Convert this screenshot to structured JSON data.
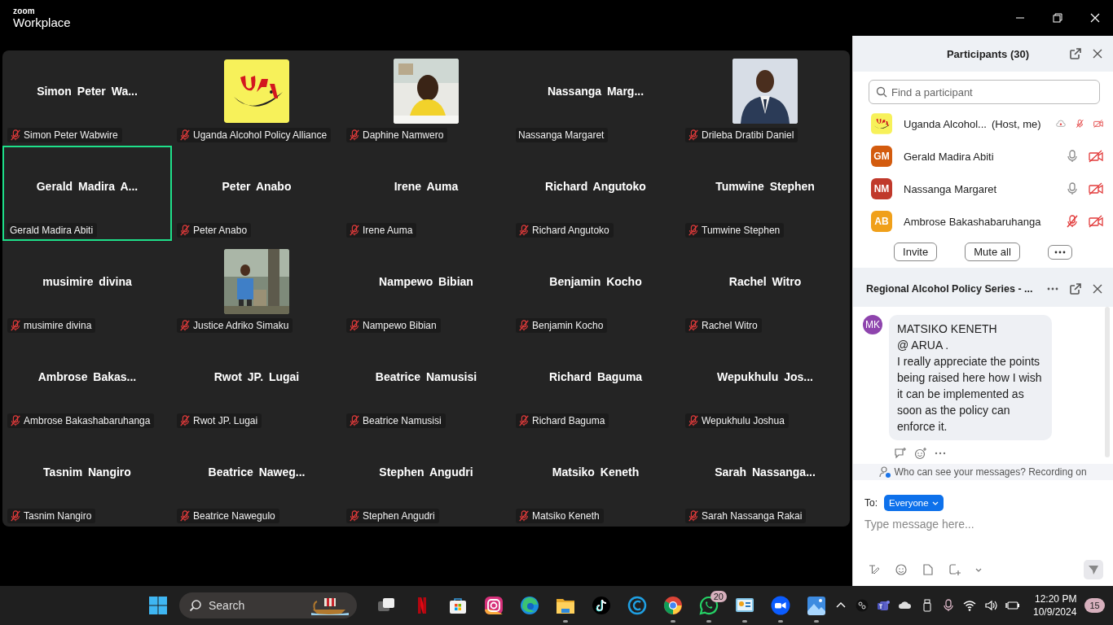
{
  "window": {
    "app_name": "zoom",
    "product": "Workplace"
  },
  "gallery": {
    "tiles": [
      {
        "kind": "name",
        "display_name": "Simon Peter Wa...",
        "label": "Simon Peter Wabwire",
        "muted": true,
        "speaking": false
      },
      {
        "kind": "logo",
        "label": "Uganda Alcohol Policy Alliance",
        "muted": true,
        "speaking": false
      },
      {
        "kind": "picture",
        "label": "Daphine Namwero",
        "muted": true,
        "speaking": false
      },
      {
        "kind": "name",
        "display_name": "Nassanga Marg...",
        "label": "Nassanga Margaret",
        "muted": false,
        "speaking": false
      },
      {
        "kind": "picture",
        "label": "Drileba Dratibi Daniel",
        "muted": true,
        "speaking": false
      },
      {
        "kind": "name",
        "display_name": "Gerald Madira A...",
        "label": "Gerald Madira Abiti",
        "muted": false,
        "speaking": true
      },
      {
        "kind": "name",
        "display_name": "Peter Anabo",
        "label": "Peter Anabo",
        "muted": true,
        "speaking": false
      },
      {
        "kind": "name",
        "display_name": "Irene Auma",
        "label": "Irene Auma",
        "muted": true,
        "speaking": false
      },
      {
        "kind": "name",
        "display_name": "Richard Angutoko",
        "label": "Richard Angutoko",
        "muted": true,
        "speaking": false
      },
      {
        "kind": "name",
        "display_name": "Tumwine Stephen",
        "label": "Tumwine Stephen",
        "muted": true,
        "speaking": false
      },
      {
        "kind": "name",
        "display_name": "musimire divina",
        "label": "musimire divina",
        "muted": true,
        "speaking": false
      },
      {
        "kind": "picture",
        "label": "Justice Adriko Simaku",
        "muted": true,
        "speaking": false
      },
      {
        "kind": "name",
        "display_name": "Nampewo Bibian",
        "label": "Nampewo Bibian",
        "muted": true,
        "speaking": false
      },
      {
        "kind": "name",
        "display_name": "Benjamin Kocho",
        "label": "Benjamin Kocho",
        "muted": true,
        "speaking": false
      },
      {
        "kind": "name",
        "display_name": "Rachel Witro",
        "label": "Rachel Witro",
        "muted": true,
        "speaking": false
      },
      {
        "kind": "name",
        "display_name": "Ambrose Bakas...",
        "label": "Ambrose Bakashabaruhanga",
        "muted": true,
        "speaking": false
      },
      {
        "kind": "name",
        "display_name": "Rwot JP. Lugai",
        "label": "Rwot JP. Lugai",
        "muted": true,
        "speaking": false
      },
      {
        "kind": "name",
        "display_name": "Beatrice Namusisi",
        "label": "Beatrice Namusisi",
        "muted": true,
        "speaking": false
      },
      {
        "kind": "name",
        "display_name": "Richard Baguma",
        "label": "Richard Baguma",
        "muted": true,
        "speaking": false
      },
      {
        "kind": "name",
        "display_name": "Wepukhulu Jos...",
        "label": "Wepukhulu Joshua",
        "muted": true,
        "speaking": false
      },
      {
        "kind": "name",
        "display_name": "Tasnim Nangiro",
        "label": "Tasnim Nangiro",
        "muted": true,
        "speaking": false
      },
      {
        "kind": "name",
        "display_name": "Beatrice Naweg...",
        "label": "Beatrice Nawegulo",
        "muted": true,
        "speaking": false
      },
      {
        "kind": "name",
        "display_name": "Stephen Angudri",
        "label": "Stephen Angudri",
        "muted": true,
        "speaking": false
      },
      {
        "kind": "name",
        "display_name": "Matsiko Keneth",
        "label": "Matsiko Keneth",
        "muted": true,
        "speaking": false
      },
      {
        "kind": "name",
        "display_name": "Sarah Nassanga...",
        "label": "Sarah Nassanga Rakai",
        "muted": true,
        "speaking": false
      }
    ]
  },
  "participants": {
    "title": "Participants (30)",
    "search": {
      "placeholder": "Find a participant"
    },
    "items": [
      {
        "kind": "picture",
        "name": "Uganda Alcohol...",
        "role": "(Host, me)",
        "recording": true,
        "muted": true,
        "video_off": true
      },
      {
        "kind": "initials",
        "initials": "GM",
        "color": "#d35b0e",
        "name": "Gerald Madira Abiti",
        "muted": false,
        "video_off": true
      },
      {
        "kind": "initials",
        "initials": "NM",
        "color": "#c0392b",
        "name": "Nassanga Margaret",
        "muted": false,
        "video_off": true
      },
      {
        "kind": "initials",
        "initials": "AB",
        "color": "#f0a01a",
        "name": "Ambrose Bakashabaruhanga",
        "muted": true,
        "video_off": true
      }
    ],
    "buttons": [
      "Invite",
      "Mute all"
    ]
  },
  "chat": {
    "title": "Regional Alcohol Policy Series - ...",
    "message": {
      "initials": "MK",
      "color": "#8e44ad",
      "text": "MATSIKO KENETH\n@ ARUA .\nI really appreciate the points being raised here how I wish it can be implemented as soon as the policy can enforce it."
    },
    "notice": "Who can see your messages? Recording on",
    "to_label": "To:",
    "recipient": "Everyone",
    "input": {
      "placeholder": "Type message here..."
    }
  },
  "taskbar": {
    "search": "Search",
    "apps": [
      {
        "kind": "taskview",
        "running": false
      },
      {
        "kind": "netflix",
        "running": false
      },
      {
        "kind": "store",
        "running": false
      },
      {
        "kind": "instagram",
        "running": false
      },
      {
        "kind": "edge",
        "running": false
      },
      {
        "kind": "folder",
        "running": true
      },
      {
        "kind": "tiktok",
        "running": false
      },
      {
        "kind": "ccleaner",
        "running": false
      },
      {
        "kind": "chrome",
        "running": true
      },
      {
        "kind": "whatsapp",
        "running": true,
        "badge": "20"
      },
      {
        "kind": "board",
        "running": true
      },
      {
        "kind": "zoom",
        "running": true
      },
      {
        "kind": "photos",
        "running": true
      }
    ],
    "time": "12:20 PM",
    "date": "10/9/2024",
    "notifications": "15"
  }
}
